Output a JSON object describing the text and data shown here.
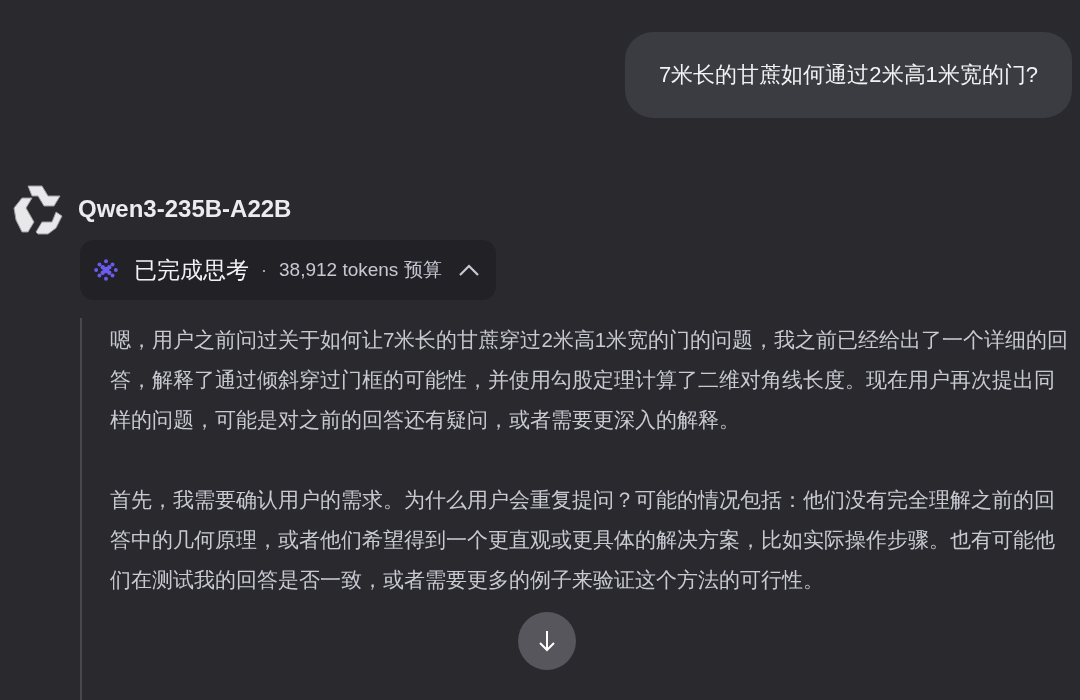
{
  "user_message": "7米长的甘蔗如何通过2米高1米宽的门?",
  "assistant": {
    "model": "Qwen3-235B-A22B",
    "thinking": {
      "label": "已完成思考",
      "separator": "·",
      "budget": "38,912 tokens 预算",
      "expanded": true,
      "paragraphs": [
        "嗯，用户之前问过关于如何让7米长的甘蔗穿过2米高1米宽的门的问题，我之前已经给出了一个详细的回答，解释了通过倾斜穿过门框的可能性，并使用勾股定理计算了二维对角线长度。现在用户再次提出同样的问题，可能是对之前的回答还有疑问，或者需要更深入的解释。",
        "首先，我需要确认用户的需求。为什么用户会重复提问？可能的情况包括：他们没有完全理解之前的回答中的几何原理，或者他们希望得到一个更直观或更具体的解决方案，比如实际操作步骤。也有可能他们在测试我的回答是否一致，或者需要更多的例子来验证这个方法的可行性。"
      ]
    }
  }
}
